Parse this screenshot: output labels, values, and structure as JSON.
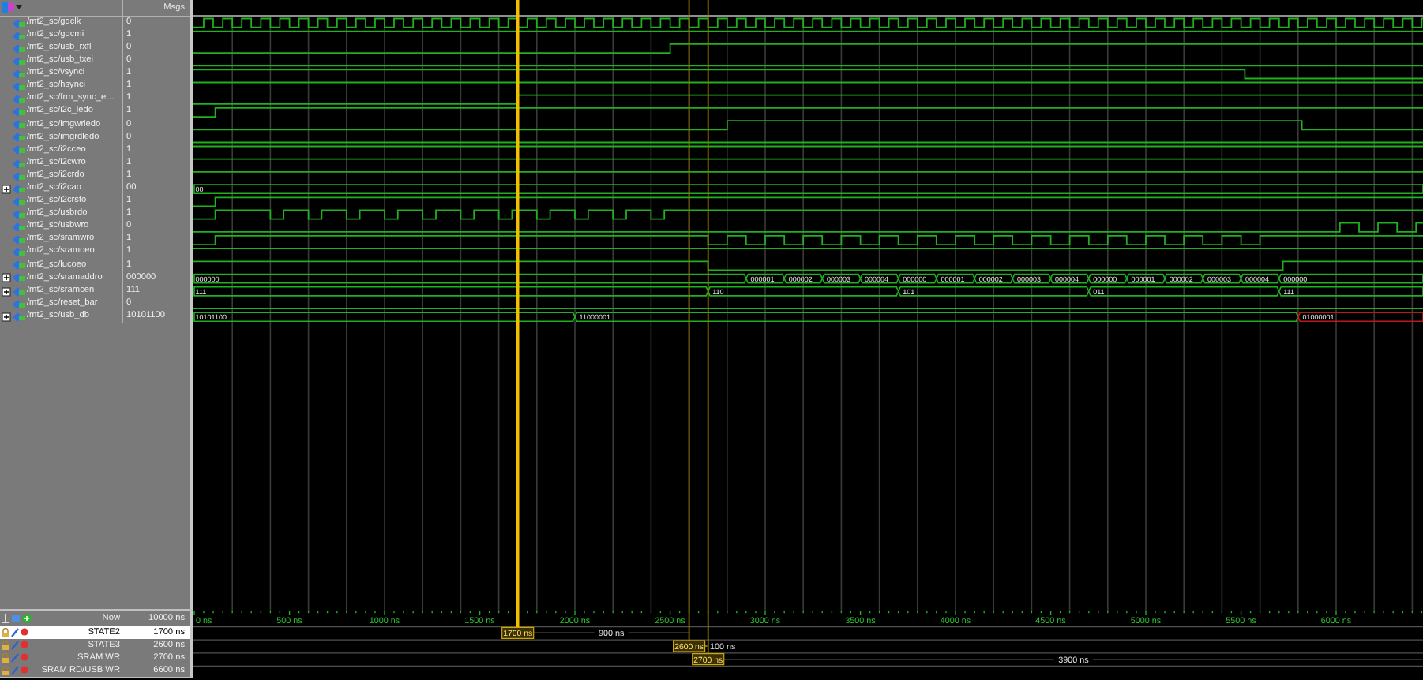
{
  "header": {
    "value_column": "Msgs"
  },
  "signals": [
    {
      "name": "/mt2_sc/gdclk",
      "value": "0",
      "kind": "bit"
    },
    {
      "name": "/mt2_sc/gdcmi",
      "value": "1",
      "kind": "bit"
    },
    {
      "name": "/mt2_sc/usb_rxfl",
      "value": "0",
      "kind": "bit"
    },
    {
      "name": "/mt2_sc/usb_txei",
      "value": "0",
      "kind": "bit"
    },
    {
      "name": "/mt2_sc/vsynci",
      "value": "1",
      "kind": "bit"
    },
    {
      "name": "/mt2_sc/hsynci",
      "value": "1",
      "kind": "bit"
    },
    {
      "name": "/mt2_sc/frm_sync_e…",
      "value": "1",
      "kind": "bit"
    },
    {
      "name": "/mt2_sc/i2c_ledo",
      "value": "1",
      "kind": "bit"
    },
    {
      "name": "/mt2_sc/imgwrledo",
      "value": "0",
      "kind": "bit"
    },
    {
      "name": "/mt2_sc/imgrdledo",
      "value": "0",
      "kind": "bit"
    },
    {
      "name": "/mt2_sc/i2cceo",
      "value": "1",
      "kind": "bit"
    },
    {
      "name": "/mt2_sc/i2cwro",
      "value": "1",
      "kind": "bit"
    },
    {
      "name": "/mt2_sc/i2crdo",
      "value": "1",
      "kind": "bit"
    },
    {
      "name": "/mt2_sc/i2cao",
      "value": "00",
      "kind": "bus",
      "expanded": false,
      "segments": [
        "00"
      ]
    },
    {
      "name": "/mt2_sc/i2crsto",
      "value": "1",
      "kind": "bit"
    },
    {
      "name": "/mt2_sc/usbrdo",
      "value": "1",
      "kind": "bit"
    },
    {
      "name": "/mt2_sc/usbwro",
      "value": "0",
      "kind": "bit"
    },
    {
      "name": "/mt2_sc/sramwro",
      "value": "1",
      "kind": "bit"
    },
    {
      "name": "/mt2_sc/sramoeo",
      "value": "1",
      "kind": "bit"
    },
    {
      "name": "/mt2_sc/lucoeo",
      "value": "1",
      "kind": "bit"
    },
    {
      "name": "/mt2_sc/sramaddro",
      "value": "000000",
      "kind": "bus",
      "expanded": false,
      "segments": [
        "000000",
        "000001",
        "000002",
        "000003",
        "000004",
        "000000",
        "000001",
        "000002",
        "000003",
        "000004",
        "000000",
        "000001",
        "000002",
        "000003",
        "000004",
        "000000"
      ]
    },
    {
      "name": "/mt2_sc/sramcen",
      "value": "111",
      "kind": "bus",
      "expanded": false,
      "segments": [
        "111",
        "110",
        "101",
        "011",
        "111"
      ]
    },
    {
      "name": "/mt2_sc/reset_bar",
      "value": "0",
      "kind": "bit"
    },
    {
      "name": "/mt2_sc/usb_db",
      "value": "10101100",
      "kind": "bus",
      "expanded": false,
      "segments": [
        "10101100",
        "11000001",
        "01000001"
      ]
    }
  ],
  "now": {
    "label": "Now",
    "value": "10000 ns"
  },
  "ruler": [
    "0 ns",
    "500 ns",
    "1000 ns",
    "1500 ns",
    "2000 ns",
    "2500 ns",
    "3000 ns",
    "3500 ns",
    "4000 ns",
    "4500 ns",
    "5000 ns",
    "5500 ns",
    "6000 ns"
  ],
  "cursors": [
    {
      "name": "STATE2",
      "value": "1700 ns",
      "selected": true,
      "tag": "1700 ns",
      "delta": "900 ns"
    },
    {
      "name": "STATE3",
      "value": "2600 ns",
      "selected": false,
      "tag": "2600 ns",
      "delta": "100 ns"
    },
    {
      "name": "SRAM WR",
      "value": "2700 ns",
      "selected": false,
      "tag": "2700 ns",
      "delta": "3900 ns"
    },
    {
      "name": "SRAM RD/USB WR",
      "value": "6600 ns",
      "selected": false
    }
  ]
}
